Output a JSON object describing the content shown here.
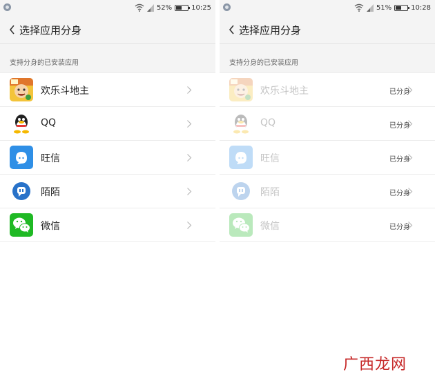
{
  "left_screen": {
    "status_bar": {
      "battery_percent": "52%",
      "time": "10:25",
      "battery_level": 0.52
    },
    "header": {
      "title": "选择应用分身"
    },
    "section_label": "支持分身的已安装应用",
    "apps": [
      {
        "name": "欢乐斗地主",
        "icon": "landlord-game-icon"
      },
      {
        "name": "QQ",
        "icon": "qq-penguin-icon"
      },
      {
        "name": "旺信",
        "icon": "wangxin-icon"
      },
      {
        "name": "陌陌",
        "icon": "momo-icon"
      },
      {
        "name": "微信",
        "icon": "wechat-icon"
      }
    ]
  },
  "right_screen": {
    "status_bar": {
      "battery_percent": "51%",
      "time": "10:28",
      "battery_level": 0.51
    },
    "header": {
      "title": "选择应用分身"
    },
    "section_label": "支持分身的已安装应用",
    "apps": [
      {
        "name": "欢乐斗地主",
        "status": "已分身",
        "icon": "landlord-game-icon"
      },
      {
        "name": "QQ",
        "status": "已分身",
        "icon": "qq-penguin-icon"
      },
      {
        "name": "旺信",
        "status": "已分身",
        "icon": "wangxin-icon"
      },
      {
        "name": "陌陌",
        "status": "已分身",
        "icon": "momo-icon"
      },
      {
        "name": "微信",
        "status": "已分身",
        "icon": "wechat-icon"
      }
    ]
  },
  "watermark": "广西龙网",
  "colors": {
    "app_bar_bg": "#f4f4f4",
    "wangxin_blue": "#2f8fe6",
    "momo_blue": "#2872c9",
    "wechat_green": "#1fb924",
    "watermark_red": "#c62828"
  }
}
